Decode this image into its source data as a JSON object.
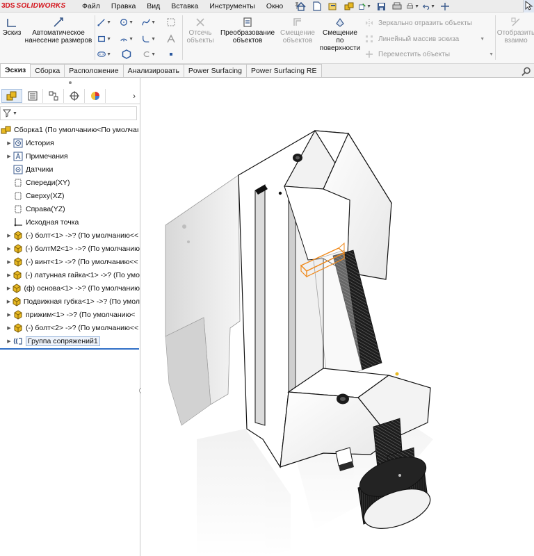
{
  "app": {
    "logo_ds": "3DS",
    "logo_text": "SOLIDWORKS"
  },
  "menu": {
    "items": [
      "Файл",
      "Правка",
      "Вид",
      "Вставка",
      "Инструменты",
      "Окно"
    ]
  },
  "ribbon": {
    "sketch": "Эскиз",
    "auto_dim_line1": "Автоматическое",
    "auto_dim_line2": "нанесение размеров",
    "trim_line1": "Отсечь",
    "trim_line2": "объекты",
    "convert_line1": "Преобразование",
    "convert_line2": "объектов",
    "offset_line1": "Смещение",
    "offset_line2": "объектов",
    "offset_surface_line1": "Смещение",
    "offset_surface_line2": "по",
    "offset_surface_line3": "поверхности",
    "mirror": "Зеркально отразить объекты",
    "linear_pattern": "Линейный массив эскиза",
    "move": "Переместить объекты",
    "display_line1": "Отобразить",
    "display_line2": "взаимо"
  },
  "tabs": [
    "Эскиз",
    "Сборка",
    "Расположение",
    "Анализировать",
    "Power Surfacing",
    "Power Surfacing RE"
  ],
  "tree": {
    "root": "Сборка1  (По умолчанию<По умолчаı",
    "items": [
      {
        "label": "История",
        "icon": "history-icon",
        "expand": true
      },
      {
        "label": "Примечания",
        "icon": "annotations-icon",
        "expand": true
      },
      {
        "label": "Датчики",
        "icon": "sensors-icon",
        "expand": false
      },
      {
        "label": "Спереди(XY)",
        "icon": "plane-icon",
        "expand": false
      },
      {
        "label": "Сверху(XZ)",
        "icon": "plane-icon",
        "expand": false
      },
      {
        "label": "Справа(YZ)",
        "icon": "plane-icon",
        "expand": false
      },
      {
        "label": "Исходная точка",
        "icon": "origin-icon",
        "expand": false
      },
      {
        "label": "(-) болт<1> ->? (По умолчанию<<",
        "icon": "part-icon",
        "expand": true
      },
      {
        "label": "(-) болтМ2<1> ->? (По умолчанию",
        "icon": "part-icon",
        "expand": true
      },
      {
        "label": "(-) винт<1> ->? (По умолчанию<<",
        "icon": "part-icon",
        "expand": true
      },
      {
        "label": "(-) латунная гайка<1> ->? (По умо",
        "icon": "part-icon",
        "expand": true
      },
      {
        "label": "(ф) основа<1> ->? (По умолчанию",
        "icon": "part-icon",
        "expand": true
      },
      {
        "label": "Подвижная губка<1> ->? (По умол",
        "icon": "part-icon",
        "expand": true
      },
      {
        "label": "прижим<1> ->? (По умолчанию<",
        "icon": "part-icon",
        "expand": true
      },
      {
        "label": "(-) болт<2> ->? (По умолчанию<<",
        "icon": "part-icon",
        "expand": true
      },
      {
        "label": "Группа сопряжений1",
        "icon": "mates-icon",
        "expand": true
      }
    ]
  },
  "colors": {
    "accent": "#2f6fc7",
    "logo_red": "#d4131b",
    "part_yellow": "#e8b923",
    "highlight_orange": "#f08a1c"
  }
}
